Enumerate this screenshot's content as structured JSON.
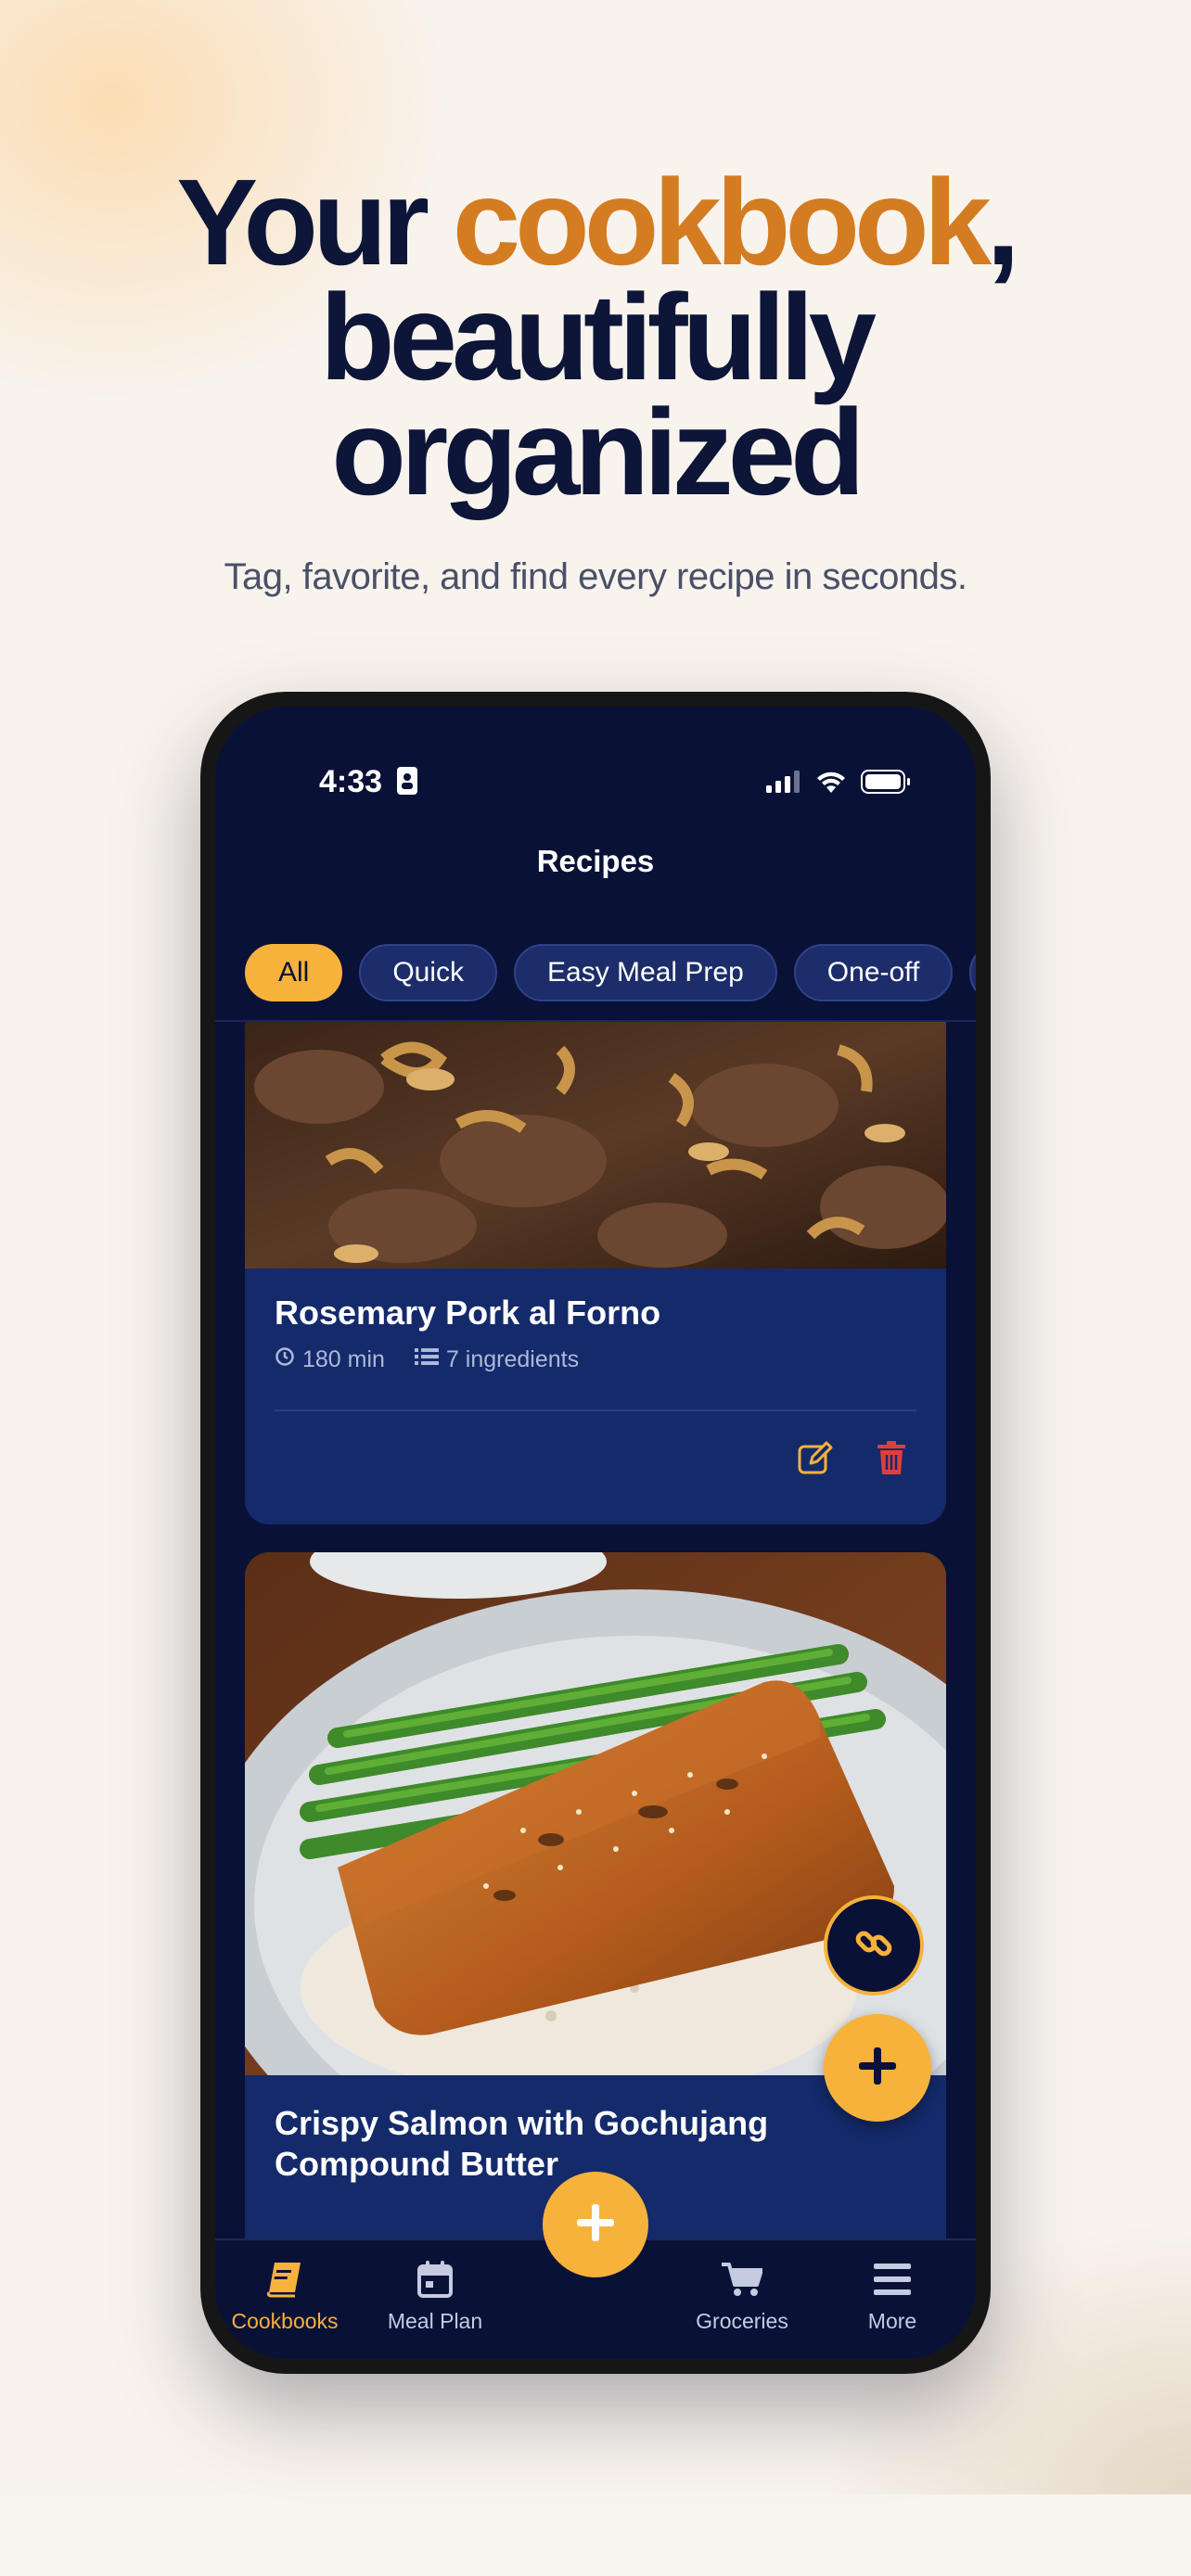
{
  "hero": {
    "title_prefix": "Your ",
    "title_accent": "cookbook",
    "title_suffix": ",",
    "title_line2": "beautifully",
    "title_line3": "organized",
    "subtitle": "Tag, favorite, and find every recipe in seconds."
  },
  "status_bar": {
    "time": "4:33"
  },
  "nav": {
    "title": "Recipes"
  },
  "filters": [
    {
      "label": "All",
      "active": true
    },
    {
      "label": "Quick",
      "active": false
    },
    {
      "label": "Easy Meal Prep",
      "active": false
    },
    {
      "label": "One-off",
      "active": false
    }
  ],
  "recipes": [
    {
      "title": "Rosemary Pork al Forno",
      "time": "180 min",
      "ingredients": "7 ingredients"
    },
    {
      "title_line1": "Crispy Salmon with Gochujang",
      "title_line2": "Compound Butter"
    }
  ],
  "tabbar": {
    "cookbooks": "Cookbooks",
    "meal_plan": "Meal Plan",
    "groceries": "Groceries",
    "more": "More"
  },
  "colors": {
    "accent": "#f6b23a",
    "headline_accent": "#d47c22",
    "navy": "#0a1137",
    "card": "#142a6b",
    "delete": "#e23d3d"
  },
  "icons": [
    "contact-card-icon",
    "signal-icon",
    "wifi-icon",
    "battery-icon",
    "clock-icon",
    "list-icon",
    "edit-icon",
    "trash-icon",
    "link-icon",
    "plus-icon",
    "book-icon",
    "calendar-icon",
    "cart-icon",
    "menu-icon"
  ]
}
